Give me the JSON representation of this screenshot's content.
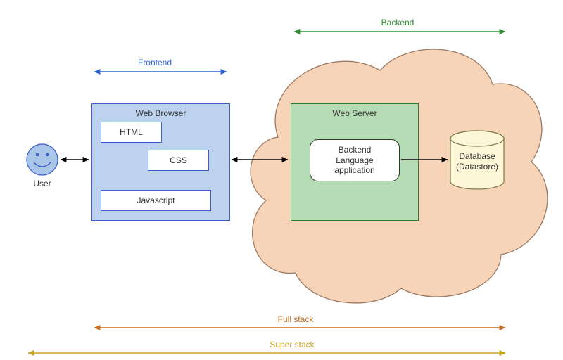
{
  "user": {
    "label": "User"
  },
  "frontend": {
    "span_label": "Frontend",
    "browser_label": "Web Browser",
    "html_label": "HTML",
    "css_label": "CSS",
    "js_label": "Javascript"
  },
  "backend": {
    "span_label": "Backend",
    "server_label": "Web Server",
    "app_label": "Backend\nLanguage\napplication",
    "db_label": "Database\n(Datastore)"
  },
  "stacks": {
    "full": "Full stack",
    "super": "Super stack"
  },
  "colors": {
    "frontend": "#2e63d6",
    "backend": "#2e8b2e",
    "full": "#c76b1e",
    "super": "#c7a61e",
    "cloud": "#f7d3b8",
    "cloud_stroke": "#9a7a63",
    "blue_fill": "#bcd2ee",
    "blue_stroke": "#3a5fcd",
    "green_fill": "#b6dcb6",
    "green_stroke": "#2e7d32",
    "db_fill": "#fdf7d8",
    "db_stroke": "#7a7a4a",
    "face_fill": "#a9c6e8",
    "face_stroke": "#3a5fcd"
  }
}
